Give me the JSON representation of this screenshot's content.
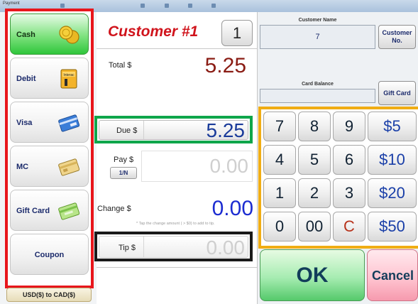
{
  "window": {
    "title": "Payment"
  },
  "payment_methods": [
    {
      "label": "Cash",
      "icon": "coins-icon"
    },
    {
      "label": "Debit",
      "icon": "interac-card-icon",
      "icon_text": "Interac"
    },
    {
      "label": "Visa",
      "icon": "visa-card-icon"
    },
    {
      "label": "MC",
      "icon": "mastercard-icon"
    },
    {
      "label": "Gift Card",
      "icon": "gift-card-icon"
    },
    {
      "label": "Coupon",
      "icon": ""
    }
  ],
  "currency_toggle": {
    "label": "USD($) to CAD($)"
  },
  "customer": {
    "title": "Customer #1",
    "number_button": "1"
  },
  "totals": {
    "total_label": "Total $",
    "total_value": "5.25",
    "due_label": "Due $",
    "due_value": "5.25",
    "pay_label": "Pay $",
    "pay_toggle": "1/N",
    "pay_value": "0.00",
    "change_label": "Change $",
    "change_value": "0.00",
    "change_hint": "* Tap the change amount ( > $0) to add to tip.",
    "tip_label": "Tip $",
    "tip_value": "0.00"
  },
  "customer_panel": {
    "name_label": "Customer Name",
    "name_value": "7",
    "customer_no_button": "Customer No.",
    "card_balance_label": "Card Balance",
    "card_balance_value": "",
    "gift_card_button": "Gift Card"
  },
  "keypad": {
    "rows": [
      [
        "7",
        "8",
        "9",
        "$5"
      ],
      [
        "4",
        "5",
        "6",
        "$10"
      ],
      [
        "1",
        "2",
        "3",
        "$20"
      ],
      [
        "0",
        "00",
        "C",
        "$50"
      ]
    ]
  },
  "actions": {
    "ok": "OK",
    "cancel": "Cancel"
  },
  "colors": {
    "left_highlight": "#e8161c",
    "due_highlight": "#0fa64b",
    "tip_highlight": "#1a1a1a",
    "keypad_highlight": "#f0ad14",
    "customer_title": "#d0141c"
  }
}
